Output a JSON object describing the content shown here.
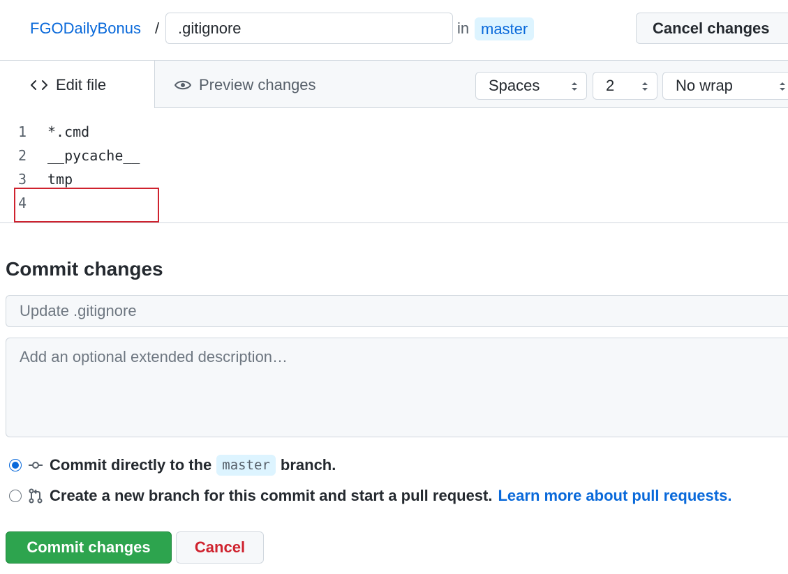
{
  "breadcrumb": {
    "repo": "FGODailyBonus",
    "separator": "/",
    "filename": ".gitignore",
    "in_label": "in",
    "branch": "master"
  },
  "header": {
    "cancel_label": "Cancel changes"
  },
  "tabs": {
    "edit_label": "Edit file",
    "preview_label": "Preview changes"
  },
  "editor_options": {
    "indent_mode": "Spaces",
    "indent_size": "2",
    "wrap_mode": "No wrap"
  },
  "code_lines": [
    {
      "number": "1",
      "text": "*.cmd"
    },
    {
      "number": "2",
      "text": "__pycache__"
    },
    {
      "number": "3",
      "text": "tmp"
    },
    {
      "number": "4",
      "text": ""
    }
  ],
  "commit": {
    "title": "Commit changes",
    "summary_placeholder": "Update .gitignore",
    "description_placeholder": "Add an optional extended description…",
    "option_direct_prefix": "Commit directly to the",
    "option_direct_branch": "master",
    "option_direct_suffix": "branch.",
    "option_new_branch": "Create a new branch for this commit and start a pull request.",
    "learn_more": "Learn more about pull requests.",
    "selected_option": "direct",
    "submit_label": "Commit changes",
    "cancel_label": "Cancel"
  },
  "colors": {
    "link": "#0969da",
    "branch_bg": "#ddf4ff",
    "commit_button": "#2da44e",
    "cancel_text": "#cf222e",
    "highlight_border": "#cf222e"
  }
}
